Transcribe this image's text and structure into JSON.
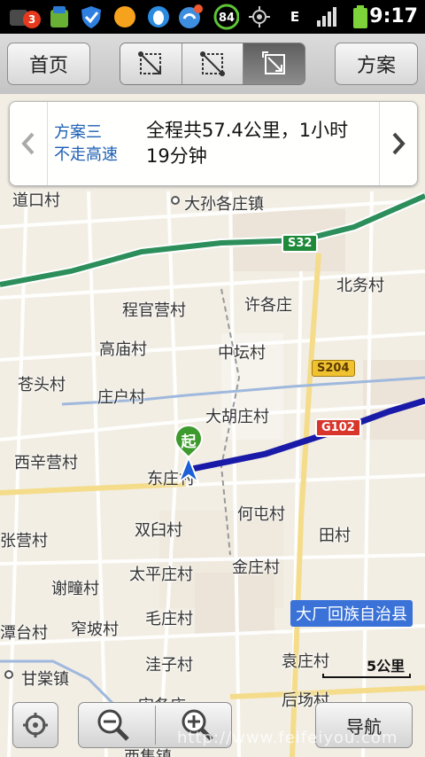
{
  "status_bar": {
    "notification_count": "3",
    "battery_ring_value": "84",
    "network_type": "E",
    "time": "9:17",
    "icons": [
      "notification-icon",
      "android-market-icon",
      "shield-icon",
      "orange-circle-icon",
      "qq-icon",
      "weibo-icon",
      "battery-ring-icon",
      "gps-icon",
      "network-icon",
      "signal-icon",
      "battery-icon"
    ]
  },
  "toolbar": {
    "home_label": "首页",
    "plan_label": "方案",
    "modes": [
      "route-overview-icon",
      "route-step-icon",
      "route-zoom-icon"
    ],
    "active_mode_index": 2
  },
  "route_card": {
    "plan_name": "方案三",
    "plan_desc": "不走高速",
    "summary": "全程共57.4公里，1小时19分钟"
  },
  "map": {
    "places": [
      {
        "name": "道口村"
      },
      {
        "name": "大孙各庄镇"
      },
      {
        "name": "北务村"
      },
      {
        "name": "许各庄"
      },
      {
        "name": "程官营村"
      },
      {
        "name": "高庙村"
      },
      {
        "name": "中坛村"
      },
      {
        "name": "苍头村"
      },
      {
        "name": "庄户村"
      },
      {
        "name": "大胡庄村"
      },
      {
        "name": "西辛营村"
      },
      {
        "name": "东庄村"
      },
      {
        "name": "何屯村"
      },
      {
        "name": "双臼村"
      },
      {
        "name": "田村"
      },
      {
        "name": "张营村"
      },
      {
        "name": "太平庄村"
      },
      {
        "name": "金庄村"
      },
      {
        "name": "谢疃村"
      },
      {
        "name": "窄坡村"
      },
      {
        "name": "毛庄村"
      },
      {
        "name": "潭台村"
      },
      {
        "name": "甘棠镇"
      },
      {
        "name": "洼子村"
      },
      {
        "name": "袁庄村"
      },
      {
        "name": "后场村"
      },
      {
        "name": "宋各庄"
      },
      {
        "name": "西集镇"
      }
    ],
    "county_label": "大厂回族自治县",
    "shields": [
      {
        "code": "S32",
        "color": "#1e8a3a",
        "text": "#fff"
      },
      {
        "code": "S204",
        "color": "#f0c230",
        "text": "#5a3a00"
      },
      {
        "code": "G102",
        "color": "#d9362b",
        "text": "#fff"
      }
    ],
    "start_marker_label": "起",
    "scale_label": "5公里",
    "route_color": "#1a1aa8",
    "highway_color": "#2c8e5a"
  },
  "controls": {
    "locate": "locate-icon",
    "zoom_out": "zoom-out-icon",
    "zoom_in": "zoom-in-icon",
    "navigate_label": "导航"
  },
  "watermark": "http://www.feifeiyou.com"
}
